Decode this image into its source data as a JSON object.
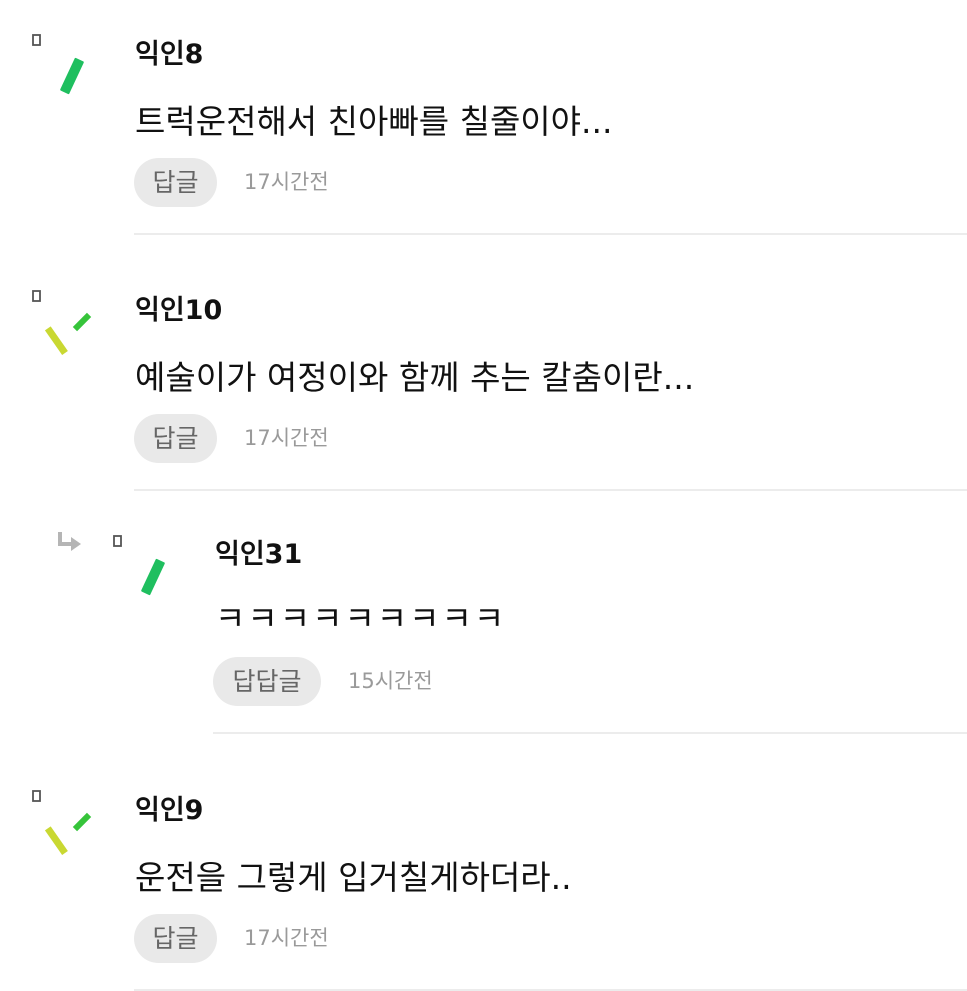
{
  "comments": [
    {
      "author": "익인8",
      "text": "트럭운전해서 친아빠를 칠줄이야...",
      "reply_label": "답글",
      "time": "17시간전",
      "avatar": "green-stick-icon"
    },
    {
      "author": "익인10",
      "text": "예술이가 여정이와 함께 추는 칼춤이란...",
      "reply_label": "답글",
      "time": "17시간전",
      "avatar": "two-sticks-icon"
    },
    {
      "author": "익인31",
      "text": "ㅋㅋㅋㅋㅋㅋㅋㅋㅋ",
      "reply_label": "답답글",
      "time": "15시간전",
      "avatar": "green-stick-icon",
      "is_reply": true
    },
    {
      "author": "익인9",
      "text": "운전을 그렇게 입거칠게하더라..",
      "reply_label": "답글",
      "time": "17시간전",
      "avatar": "two-sticks-icon"
    }
  ],
  "colors": {
    "green": "#1fbf5f",
    "lime": "#c9d832",
    "light_green": "#36c43a",
    "reply_bg": "#e9e9e9",
    "divider": "#ececec"
  }
}
